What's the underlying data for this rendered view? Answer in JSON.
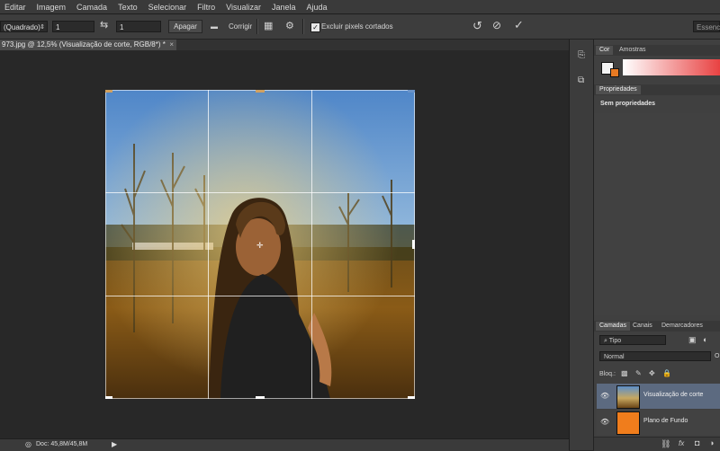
{
  "menu": [
    "Editar",
    "Imagem",
    "Camada",
    "Texto",
    "Selecionar",
    "Filtro",
    "Visualizar",
    "Janela",
    "Ajuda"
  ],
  "options": {
    "ratio_select": "(Quadrado)",
    "width_value": "1",
    "swap_icon": "swap-arrows-icon",
    "height_value": "1",
    "clear_button": "Apagar",
    "straighten_label": "Corrigir",
    "delete_cropped_checkbox": "Excluir pixels cortados",
    "workspace": "Essenci"
  },
  "document": {
    "tab_title": "973.jpg @ 12,5% (Visualização de corte, RGB/8*) *",
    "status": "Doc: 45,8M/45,8M"
  },
  "color_panel": {
    "tabs": [
      "Cor",
      "Amostras"
    ],
    "foreground": "#f2f2f2",
    "background": "#e87a23"
  },
  "properties_panel": {
    "tab": "Propriedades",
    "content": "Sem propriedades"
  },
  "layers_panel": {
    "tabs": [
      "Camadas",
      "Canais",
      "Demarcadores"
    ],
    "filter": "Tipo",
    "blend_mode": "Normal",
    "opacity_initial": "O",
    "lock_label": "Bloq.:",
    "layers": [
      {
        "name": "Visualização de corte",
        "selected": true
      },
      {
        "name": "Plano de Fundo",
        "selected": false,
        "color": "#f07d1c"
      }
    ]
  }
}
